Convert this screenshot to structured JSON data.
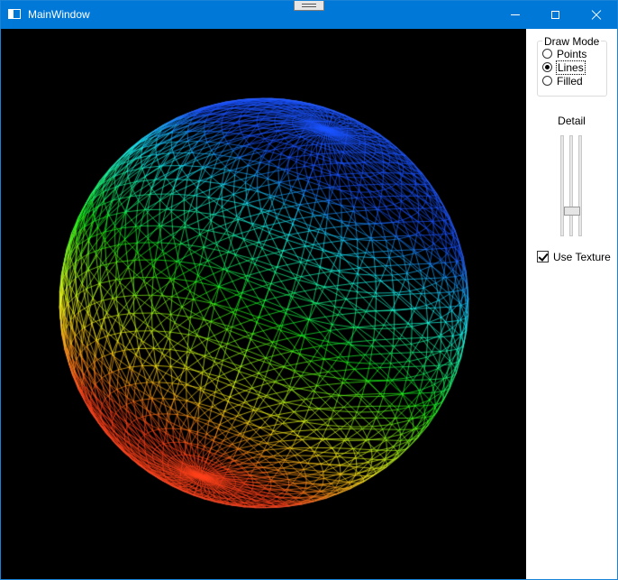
{
  "window": {
    "title": "MainWindow"
  },
  "panel": {
    "draw_mode": {
      "title": "Draw Mode",
      "options": [
        {
          "label": "Points",
          "selected": false
        },
        {
          "label": "Lines",
          "selected": true
        },
        {
          "label": "Filled",
          "selected": false
        }
      ]
    },
    "detail": {
      "label": "Detail",
      "level": 0.25
    },
    "use_texture": {
      "label": "Use Texture",
      "checked": true
    }
  },
  "colors": {
    "titlebar": "#0078d7",
    "viewport_bg": "#000000"
  },
  "icons": [
    "app-icon",
    "minimize-icon",
    "maximize-icon",
    "close-icon"
  ]
}
